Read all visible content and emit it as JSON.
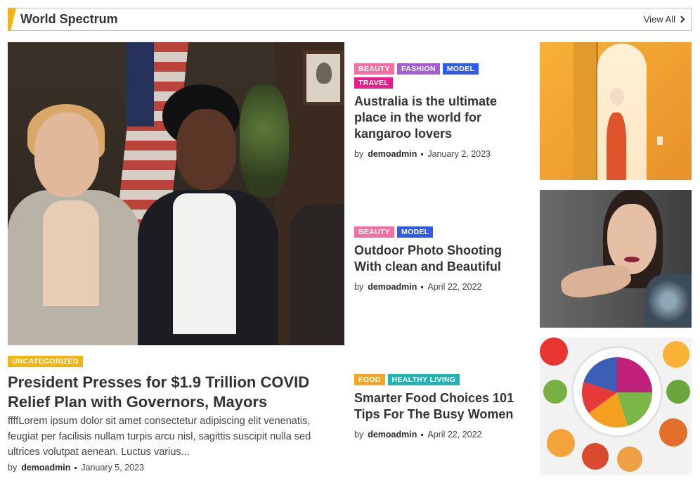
{
  "section": {
    "title": "World Spectrum",
    "view_all": "View All"
  },
  "featured": {
    "category": "UNCATEGORIZED",
    "category_color": "#f5b50b",
    "title": "President Presses for $1.9 Trillion COVID Relief Plan with Governors, Mayors",
    "excerpt": "ffffLorem ipsum dolor sit amet consectetur adipiscing elit venenatis, feugiat per facilisis nullam turpis arcu nisl, sagittis suscipit nulla sed ultrices volutpat aenean. Luctus varius...",
    "by": "by",
    "author": "demoadmin",
    "date": "January 5, 2023"
  },
  "posts": [
    {
      "tags": [
        {
          "label": "BEAUTY",
          "color": "#f46fa1"
        },
        {
          "label": "FASHION",
          "color": "#a45ed6"
        },
        {
          "label": "MODEL",
          "color": "#2f5bea"
        },
        {
          "label": "TRAVEL",
          "color": "#e91e8c"
        }
      ],
      "title": "Australia is the ultimate place in the world for kangaroo lovers",
      "by": "by",
      "author": "demoadmin",
      "date": "January 2, 2023"
    },
    {
      "tags": [
        {
          "label": "BEAUTY",
          "color": "#f46fa1"
        },
        {
          "label": "MODEL",
          "color": "#2f5bea"
        }
      ],
      "title": "Outdoor Photo Shooting With clean and Beautiful",
      "by": "by",
      "author": "demoadmin",
      "date": "April 22, 2022"
    },
    {
      "tags": [
        {
          "label": "FOOD",
          "color": "#f5a623"
        },
        {
          "label": "HEALTHY LIVING",
          "color": "#1fb5b5"
        }
      ],
      "title": "Smarter Food Choices 101 Tips For The Busy Women",
      "by": "by",
      "author": "demoadmin",
      "date": "April 22, 2022"
    }
  ]
}
